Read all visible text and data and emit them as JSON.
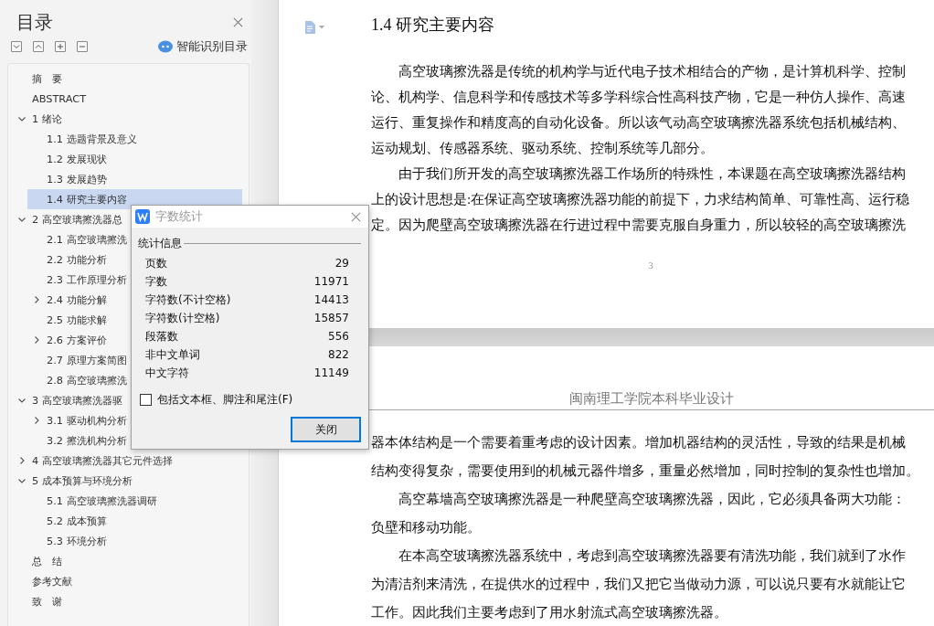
{
  "sidebar": {
    "title": "目录",
    "smart_toc_label": "智能识别目录",
    "items": [
      {
        "label": "摘　要",
        "selected": false
      },
      {
        "label": "ABSTRACT",
        "selected": false
      },
      {
        "label": "1  绪论",
        "selected": false,
        "expanded": true,
        "children": [
          {
            "label": "1.1 选题背景及意义",
            "selected": false
          },
          {
            "label": "1.2 发展现状",
            "selected": false
          },
          {
            "label": "1.3 发展趋势",
            "selected": false
          },
          {
            "label": "1.4 研究主要内容",
            "selected": true
          }
        ]
      },
      {
        "label": "2  高空玻璃擦洗器总",
        "selected": false,
        "expanded": true,
        "children": [
          {
            "label": "2.1 高空玻璃擦洗",
            "selected": false
          },
          {
            "label": "2.2 功能分析",
            "selected": false
          },
          {
            "label": "2.3 工作原理分析",
            "selected": false
          },
          {
            "label": "2.4 功能分解",
            "selected": false,
            "expanded": false
          },
          {
            "label": "2.5 功能求解",
            "selected": false
          },
          {
            "label": "2.6 方案评价",
            "selected": false,
            "expanded": false
          },
          {
            "label": "2.7 原理方案简图",
            "selected": false
          },
          {
            "label": "2.8 高空玻璃擦洗",
            "selected": false
          }
        ]
      },
      {
        "label": "3  高空玻璃擦洗器驱",
        "selected": false,
        "expanded": true,
        "children": [
          {
            "label": "3.1 驱动机构分析",
            "selected": false,
            "expanded": false
          },
          {
            "label": "3.2 擦洗机构分析",
            "selected": false
          }
        ]
      },
      {
        "label": "4  高空玻璃擦洗器其它元件选择",
        "selected": false,
        "expanded": false
      },
      {
        "label": "5  成本预算与环境分析",
        "selected": false,
        "expanded": true,
        "children": [
          {
            "label": "5.1  高空玻璃擦洗器调研",
            "selected": false
          },
          {
            "label": "5.2  成本预算",
            "selected": false
          },
          {
            "label": "5.3  环境分析",
            "selected": false
          }
        ]
      },
      {
        "label": "总　结",
        "selected": false
      },
      {
        "label": "参考文献",
        "selected": false
      },
      {
        "label": "致　谢",
        "selected": false
      }
    ]
  },
  "document": {
    "pages": [
      {
        "heading": "1.4 研究主要内容",
        "page_number": "3",
        "paragraphs": [
          {
            "indent": true,
            "lines": [
              "高空玻璃擦洗器是传统的机构学与近代电子技术相结合的产物，是计算机科学、控制",
              "论、机构学、信息科学和传感技术等多学科综合性高科技产物，它是一种仿人操作、高速",
              "运行、重复操作和精度高的自动化设备。所以该气动高空玻璃擦洗器系统包括机械结构、",
              "运动规划、传感器系统、驱动系统、控制系统等几部分。"
            ]
          },
          {
            "indent": true,
            "lines": [
              "由于我们所开发的高空玻璃擦洗器工作场所的特殊性，本课题在高空玻璃擦洗器结构",
              "上的设计思想是:在保证高空玻璃擦洗器功能的前提下，力求结构简单、可靠性高、运行稳",
              "定。因为爬壁高空玻璃擦洗器在行进过程中需要克服自身重力，所以较轻的高空玻璃擦洗"
            ]
          }
        ]
      },
      {
        "header": "闽南理工学院本科毕业设计",
        "paragraphs": [
          {
            "indent": false,
            "lines": [
              "器本体结构是一个需要着重考虑的设计因素。增加机器结构的灵活性，导致的结果是机械",
              "结构变得复杂，需要使用到的机械元器件增多，重量必然增加，同时控制的复杂性也增加。"
            ]
          },
          {
            "indent": true,
            "lines": [
              "高空幕墙高空玻璃擦洗器是一种爬壁高空玻璃擦洗器，因此，它必须具备两大功能：",
              "负壁和移动功能。"
            ]
          },
          {
            "indent": true,
            "lines": [
              "在本高空玻璃擦洗器系统中，考虑到高空玻璃擦洗器要有清洗功能，我们就到了水作",
              "为清洁剂来清洗，在提供水的过程中，我们又把它当做动力源，可以说只要有水就能让它",
              "工作。因此我们主要考虑到了用水射流式高空玻璃擦洗器。"
            ]
          }
        ]
      }
    ]
  },
  "dialog": {
    "title": "字数统计",
    "group_label": "统计信息",
    "stats": [
      {
        "label": "页数",
        "value": "29"
      },
      {
        "label": "字数",
        "value": "11971"
      },
      {
        "label": "字符数(不计空格)",
        "value": "14413"
      },
      {
        "label": "字符数(计空格)",
        "value": "15857"
      },
      {
        "label": "段落数",
        "value": "556"
      },
      {
        "label": "非中文单词",
        "value": "822"
      },
      {
        "label": "中文字符",
        "value": "11149"
      }
    ],
    "checkbox": {
      "label": "包括文本框、脚注和尾注(F)",
      "checked": false
    },
    "button": "关闭"
  }
}
